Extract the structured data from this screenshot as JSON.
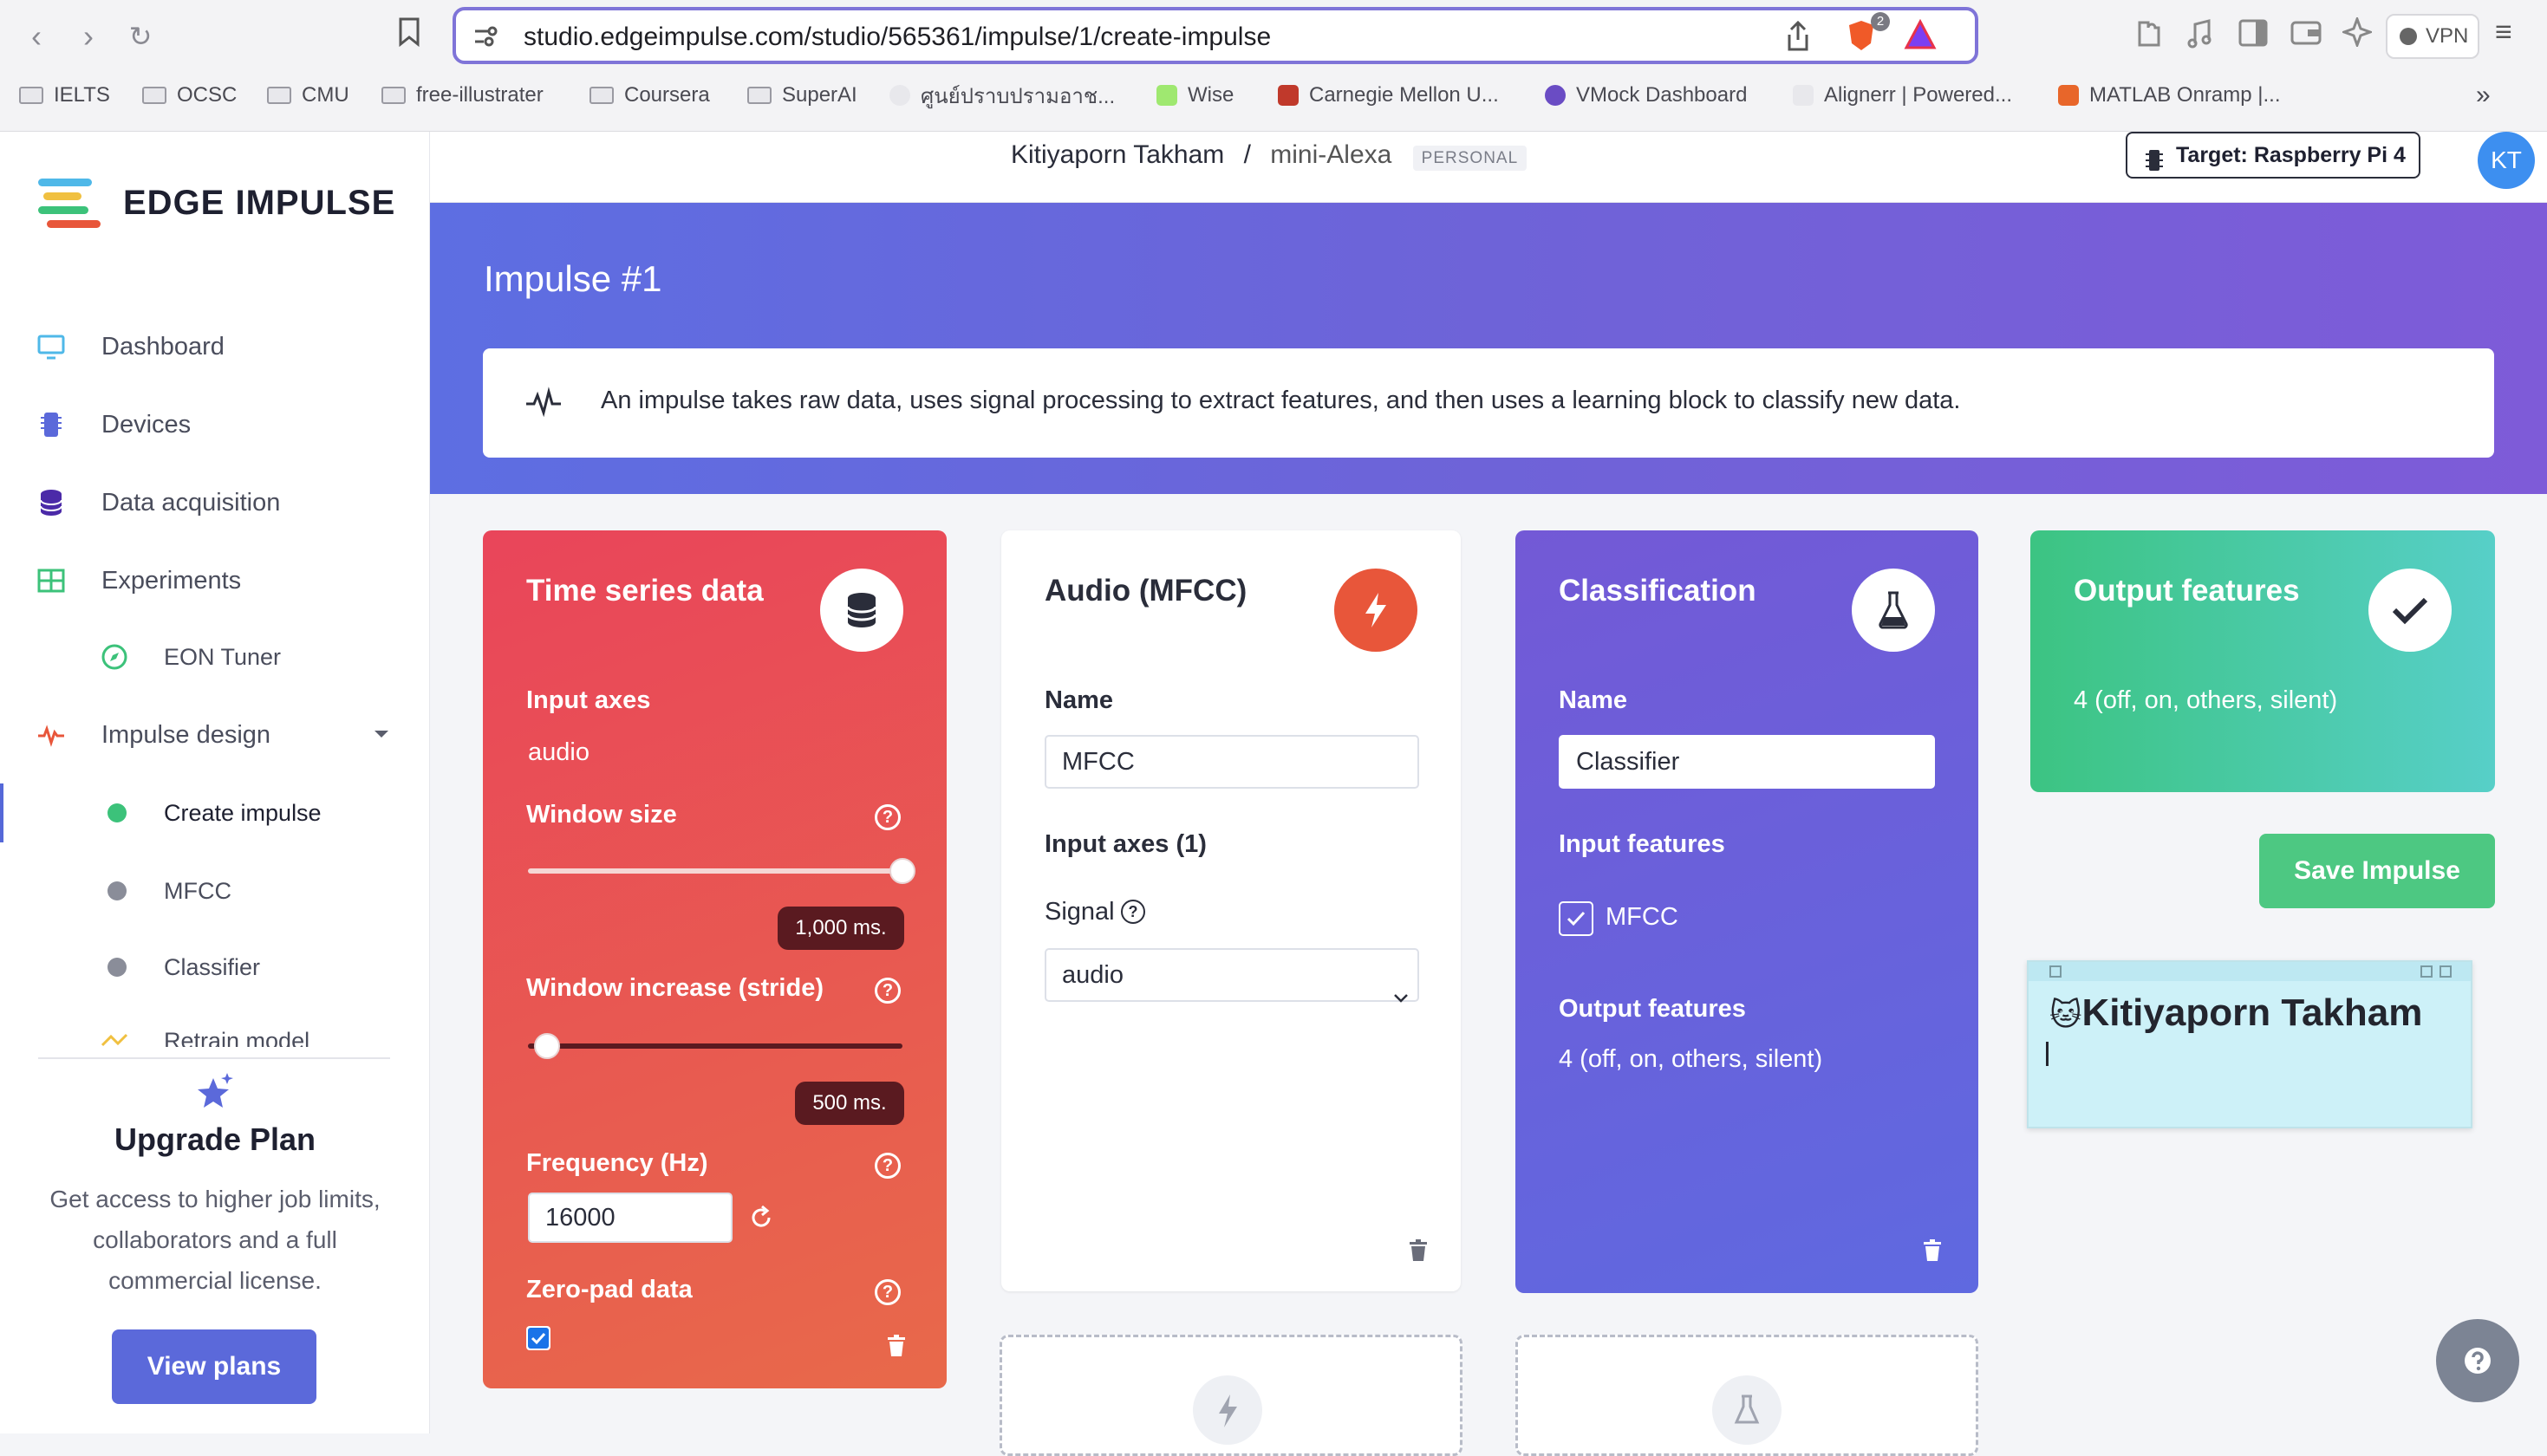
{
  "browser": {
    "url": "studio.edgeimpulse.com/studio/565361/impulse/1/create-impulse",
    "shield_count": "2",
    "vpn_label": "VPN",
    "bookmarks": [
      "IELTS",
      "OCSC",
      "CMU",
      "free-illustrater",
      "Coursera",
      "SuperAI",
      "ศูนย์ปราบปรามอาช...",
      "Wise",
      "Carnegie Mellon U...",
      "VMock Dashboard",
      "Alignerr | Powered...",
      "MATLAB Onramp |..."
    ]
  },
  "sidebar": {
    "brand": "EDGE IMPULSE",
    "nav": {
      "dashboard": "Dashboard",
      "devices": "Devices",
      "data_acquisition": "Data acquisition",
      "experiments": "Experiments",
      "eon_tuner": "EON Tuner",
      "impulse_design": "Impulse design",
      "create_impulse": "Create impulse",
      "mfcc": "MFCC",
      "classifier": "Classifier",
      "retrain": "Retrain model"
    },
    "upgrade": {
      "title": "Upgrade Plan",
      "text": "Get access to higher job limits, collaborators and a full commercial license.",
      "button": "View plans"
    }
  },
  "header": {
    "user": "Kitiyaporn Takham",
    "separator": "/",
    "project": "mini-Alexa",
    "tag": "PERSONAL",
    "target": "Target: Raspberry Pi 4",
    "avatar": "KT"
  },
  "hero": {
    "title": "Impulse #1",
    "info": "An impulse takes raw data, uses signal processing to extract features, and then uses a learning block to classify new data."
  },
  "time_series": {
    "title": "Time series data",
    "input_axes_label": "Input axes",
    "input_axes_value": "audio",
    "window_size_label": "Window size",
    "window_size_value": "1,000 ms.",
    "window_size_fraction": 1.0,
    "stride_label": "Window increase (stride)",
    "stride_value": "500 ms.",
    "stride_fraction": 0.05,
    "frequency_label": "Frequency (Hz)",
    "frequency_value": "16000",
    "zeropad_label": "Zero-pad data",
    "zeropad_checked": true
  },
  "mfcc_block": {
    "title": "Audio (MFCC)",
    "name_label": "Name",
    "name_value": "MFCC",
    "input_axes_label": "Input axes (1)",
    "signal_label": "Signal",
    "signal_value": "audio"
  },
  "classification": {
    "title": "Classification",
    "name_label": "Name",
    "name_value": "Classifier",
    "input_features_label": "Input features",
    "input_feature": "MFCC",
    "output_features_label": "Output features",
    "output_features_value": "4 (off, on, others, silent)"
  },
  "output": {
    "title": "Output features",
    "value": "4 (off, on, others, silent)"
  },
  "save_label": "Save Impulse",
  "note": {
    "text": "Kitiyaporn Takham"
  },
  "colors": {
    "accent": "#5b69da",
    "time_series": "#e9455a",
    "classification": "#7359d6",
    "output": "#3cc482",
    "save": "#4dc882"
  }
}
